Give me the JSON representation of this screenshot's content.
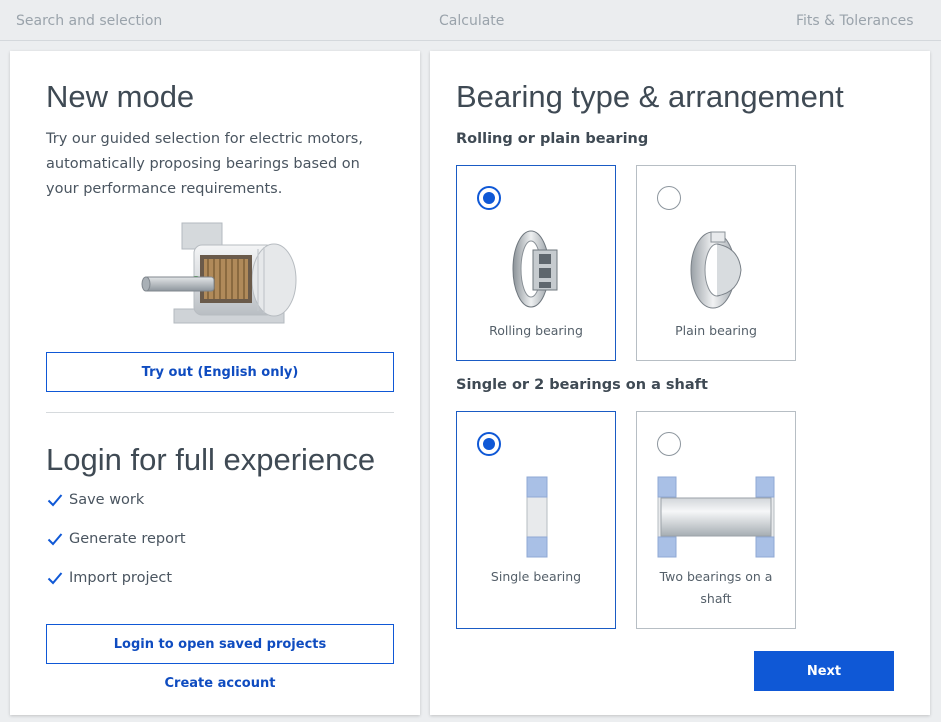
{
  "topnav": {
    "tabs": [
      {
        "label": "Search and selection"
      },
      {
        "label": "Calculate"
      },
      {
        "label": "Fits & Tolerances"
      }
    ]
  },
  "left": {
    "new_mode": {
      "title": "New mode",
      "description": "Try our guided selection for electric motors, automatically proposing bearings based on your performance requirements.",
      "image": "electric-motor-illustration",
      "button_label": "Try out (English only)"
    },
    "login": {
      "title": "Login for full experience",
      "benefits": [
        "Save work",
        "Generate report",
        "Import project"
      ],
      "button_label": "Login to open saved projects",
      "create_account": "Create account"
    }
  },
  "right": {
    "title": "Bearing type & arrangement",
    "group1": {
      "label": "Rolling or plain bearing",
      "options": [
        {
          "label": "Rolling bearing",
          "selected": true,
          "icon": "rolling-bearing-icon"
        },
        {
          "label": "Plain bearing",
          "selected": false,
          "icon": "plain-bearing-icon"
        }
      ]
    },
    "group2": {
      "label": "Single or 2 bearings on a shaft",
      "options": [
        {
          "label": "Single bearing",
          "selected": true,
          "icon": "single-bearing-icon"
        },
        {
          "label": "Two bearings on a shaft",
          "selected": false,
          "icon": "two-bearings-shaft-icon"
        }
      ]
    },
    "next_label": "Next"
  },
  "colors": {
    "accent": "#0f58d6",
    "background": "#eceef0",
    "text": "#3f4a54"
  }
}
